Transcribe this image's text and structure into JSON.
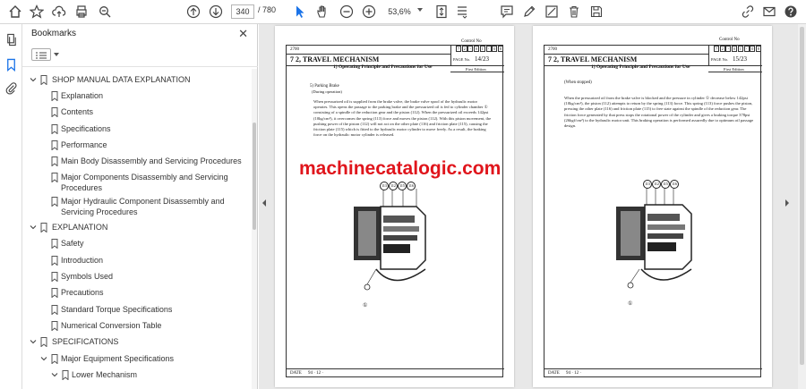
{
  "toolbar": {
    "page_current": "340",
    "page_total": "/ 780",
    "zoom": "53,6%"
  },
  "bookmarks": {
    "title": "Bookmarks",
    "items": [
      {
        "label": "SHOP MANUAL DATA EXPLANATION",
        "level": 0,
        "expanded": true
      },
      {
        "label": "Explanation",
        "level": 1
      },
      {
        "label": "Contents",
        "level": 1
      },
      {
        "label": "Specifications",
        "level": 1
      },
      {
        "label": "Performance",
        "level": 1
      },
      {
        "label": "Main Body Disassembly and Servicing Procedures",
        "level": 1
      },
      {
        "label": "Major Components Disassembly and Servicing Procedures",
        "level": 1
      },
      {
        "label": "Major Hydraulic Component Disassembly and Servicing Procedures",
        "level": 1
      },
      {
        "label": "EXPLANATION",
        "level": 0,
        "expanded": true
      },
      {
        "label": "Safety",
        "level": 1
      },
      {
        "label": "Introduction",
        "level": 1
      },
      {
        "label": "Symbols Used",
        "level": 1
      },
      {
        "label": "Precautions",
        "level": 1
      },
      {
        "label": "Standard Torque Specifications",
        "level": 1
      },
      {
        "label": "Numerical Conversion Table",
        "level": 1
      },
      {
        "label": "SPECIFICATIONS",
        "level": 0,
        "expanded": true
      },
      {
        "label": "Major Equipment Specifications",
        "level": 1,
        "expanded": true
      },
      {
        "label": "Lower Mechanism",
        "level": 2,
        "expanded": true
      }
    ]
  },
  "page_left": {
    "code": "2700",
    "control_no": "Control No",
    "control_digits": [
      "7",
      "2",
      "-",
      "0",
      "1",
      "-",
      "0",
      "8"
    ],
    "heading": "7 2,   TRAVEL MECHANISM",
    "subheading": "1)   Operating Principle and Precautions for Use",
    "page_label": "PAGE No.",
    "page_no": "14/23",
    "edition": "First Edition",
    "section": "5) Parking Brake",
    "section_sub": "(During operation)",
    "body": "When pressurized oil is supplied from the brake valve, the brake valve spool of the hydraulic motor operates. This opens the passage to the parking brake and the pressurized oil is fed to cylinder chamber ① consisting of a spindle of the reduction gear and the piston (112). When the pressurized oil exceeds 142psi (10kg/cm²), it overcomes the spring (113) force and moves the piston (112). With this piston movement, the pushing power of the piston (112) will not act on the other plate (116) and friction plate (115), causing the friction plate (115) which is fitted to the hydraulic motor cylinder to move freely. As a result, the braking force on the hydraulic motor cylinder is released.",
    "callouts": [
      "113",
      "112",
      "115",
      "116"
    ],
    "callout_bottom": "①",
    "date_label": "DATE",
    "date_value": "94 · 12 ·"
  },
  "page_right": {
    "code": "2700",
    "control_no": "Control No",
    "control_digits": [
      "7",
      "2",
      "-",
      "0",
      "1",
      "-",
      "0",
      "8"
    ],
    "heading": "7 2,   TRAVEL MECHANISM",
    "subheading": "1)   Operating Principle and Precautions for Use",
    "page_label": "PAGE No.",
    "page_no": "15/23",
    "edition": "First Edition",
    "section": "(When stopped)",
    "body": "When the pressurized oil from the brake valve is blocked and the pressure in cylinder ① decrease below 142psi (10kg/cm²), the piston (112) attempts to return by the spring (113) force. This spring (113) force pushes the piston, pressing the other plate (116) and friction plate (115) to free state against the spindle of the reduction gear. The friction force generated by that press stops the rotational power of the cylinder and gives a braking torque 378psi (26kgf/cm²) to the hydraulic motor unit. This braking operation is performed assuredly due to optimum oil passage design.",
    "callouts": [
      "113",
      "112",
      "115",
      "116"
    ],
    "callout_bottom": "①",
    "date_label": "DATE",
    "date_value": "94 · 12 ·"
  },
  "watermark": "machinecatalogic.com",
  "colors": {
    "watermark": "#e0151c",
    "accent": "#1a73e8"
  }
}
